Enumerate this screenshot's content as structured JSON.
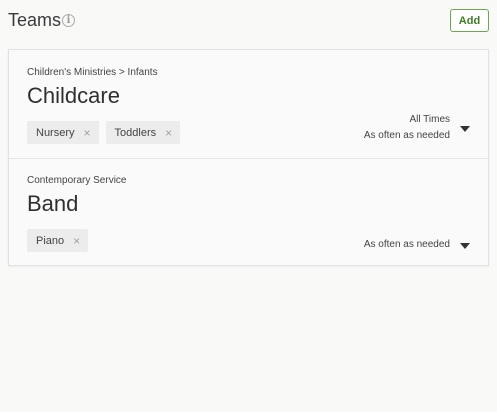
{
  "header": {
    "title": "Teams",
    "info_icon": "info-icon",
    "add_label": "Add"
  },
  "colors": {
    "accent": "#6aa84f",
    "accent_text": "#3d7d22"
  },
  "teams": [
    {
      "breadcrumb": "Children's Ministries > Infants",
      "name": "Childcare",
      "positions": [
        {
          "label": "Nursery",
          "remove": "×"
        },
        {
          "label": "Toddlers",
          "remove": "×"
        }
      ],
      "times": "All Times",
      "frequency": "As often as needed"
    },
    {
      "breadcrumb": "Contemporary Service",
      "name": "Band",
      "positions": [
        {
          "label": "Piano",
          "remove": "×"
        }
      ],
      "frequency": "As often as needed"
    }
  ]
}
